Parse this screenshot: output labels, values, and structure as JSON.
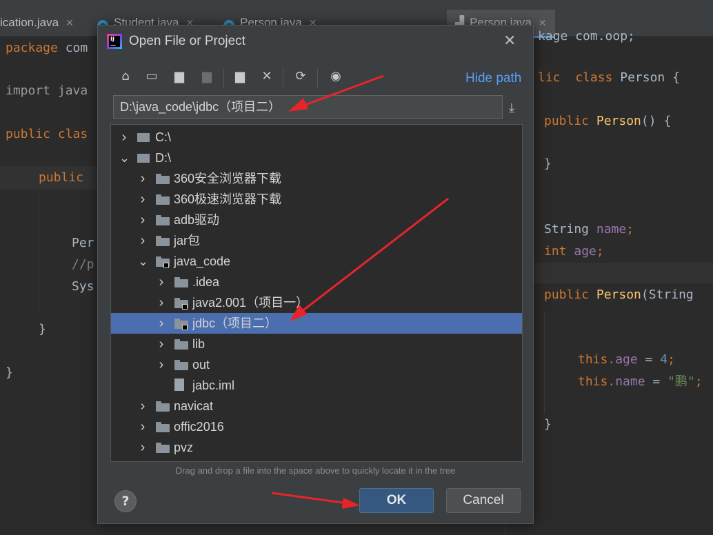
{
  "editor_tabs": {
    "left": [
      {
        "label": "ication.java",
        "icon": "java-class-icon"
      },
      {
        "label": "Student.java",
        "icon": "java-class-icon"
      },
      {
        "label": "Person.java",
        "icon": "java-class-icon"
      }
    ],
    "right": {
      "label": "Person.java"
    }
  },
  "left_code": {
    "package_kw": "package",
    "package_rest": " com",
    "import_kw": "import",
    "import_rest": " java",
    "public_kw": "public",
    "class_kw": " clas",
    "public2": "public",
    "per": "Per",
    "comment": "//p",
    "sys": "Sys",
    "brace1": "}",
    "brace2": "}"
  },
  "right_code": {
    "line1": "kage com.oop;",
    "l_public": "lic",
    "l_class": "class",
    "l_person": "Person {",
    "ctor_public": "public",
    "ctor_name": "Person",
    "ctor_rest": "() {",
    "brace": "}",
    "string_type": "String",
    "name_field": "name",
    "semi1": ";",
    "int_type": "int",
    "age_field": "age",
    "semi2": ";",
    "ctor2_public": "public",
    "ctor2_name": "Person",
    "ctor2_rest": "(String",
    "this1": "this",
    "dot_age": ".age",
    "eq1": " = ",
    "num4": "4",
    "semi3": ";",
    "this2": "this",
    "dot_name": ".name",
    "eq2": " = ",
    "str": "\"鹏\"",
    "semi4": ";",
    "brace2": "}"
  },
  "dialog": {
    "title": "Open File or Project",
    "hide_path": "Hide path",
    "path_value": "D:\\java_code\\jdbc（项目二）",
    "hint": "Drag and drop a file into the space above to quickly locate it in the tree",
    "ok": "OK",
    "cancel": "Cancel",
    "help": "?"
  },
  "tree": [
    {
      "label": "C:\\",
      "depth": 0,
      "expanded": false,
      "kind": "drive"
    },
    {
      "label": "D:\\",
      "depth": 0,
      "expanded": true,
      "kind": "drive"
    },
    {
      "label": "360安全浏览器下载",
      "depth": 1,
      "expanded": false,
      "kind": "folder"
    },
    {
      "label": "360极速浏览器下载",
      "depth": 1,
      "expanded": false,
      "kind": "folder"
    },
    {
      "label": "adb驱动",
      "depth": 1,
      "expanded": false,
      "kind": "folder"
    },
    {
      "label": "jar包",
      "depth": 1,
      "expanded": false,
      "kind": "folder"
    },
    {
      "label": "java_code",
      "depth": 1,
      "expanded": true,
      "kind": "project"
    },
    {
      "label": ".idea",
      "depth": 2,
      "expanded": false,
      "kind": "folder"
    },
    {
      "label": "java2.001（项目一）",
      "depth": 2,
      "expanded": false,
      "kind": "project"
    },
    {
      "label": "jdbc（项目二）",
      "depth": 2,
      "expanded": false,
      "kind": "project",
      "selected": true
    },
    {
      "label": "lib",
      "depth": 2,
      "expanded": false,
      "kind": "folder"
    },
    {
      "label": "out",
      "depth": 2,
      "expanded": false,
      "kind": "folder"
    },
    {
      "label": "jabc.iml",
      "depth": 2,
      "expanded": null,
      "kind": "file"
    },
    {
      "label": "navicat",
      "depth": 1,
      "expanded": false,
      "kind": "folder"
    },
    {
      "label": "offic2016",
      "depth": 1,
      "expanded": false,
      "kind": "folder"
    },
    {
      "label": "pvz",
      "depth": 1,
      "expanded": false,
      "kind": "folder"
    }
  ],
  "colors": {
    "selection": "#4b6eaf",
    "ok_button": "#365880",
    "link": "#589df6",
    "annotation_arrow": "#e8242b"
  }
}
